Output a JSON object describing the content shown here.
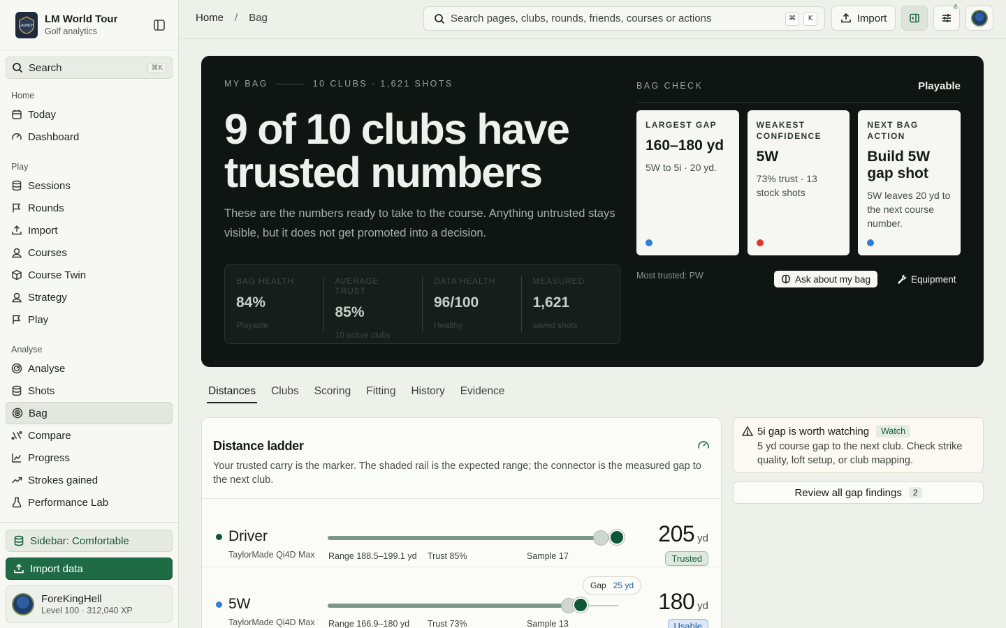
{
  "app": {
    "name": "LM World Tour",
    "subtitle": "Golf analytics"
  },
  "sidebar": {
    "search_label": "Search",
    "search_shortcut": "⌘K",
    "sections": [
      {
        "title": "Home",
        "items": [
          {
            "label": "Today",
            "icon": "calendar-icon"
          },
          {
            "label": "Dashboard",
            "icon": "gauge-icon"
          }
        ]
      },
      {
        "title": "Play",
        "items": [
          {
            "label": "Sessions",
            "icon": "database-icon"
          },
          {
            "label": "Rounds",
            "icon": "flag-icon"
          },
          {
            "label": "Import",
            "icon": "upload-icon"
          },
          {
            "label": "Courses",
            "icon": "map-pin-icon"
          },
          {
            "label": "Course Twin",
            "icon": "cube-icon"
          },
          {
            "label": "Strategy",
            "icon": "map-pin-icon"
          },
          {
            "label": "Play",
            "icon": "flag-icon"
          }
        ]
      },
      {
        "title": "Analyse",
        "items": [
          {
            "label": "Analyse",
            "icon": "radar-icon"
          },
          {
            "label": "Shots",
            "icon": "database-icon"
          },
          {
            "label": "Bag",
            "icon": "target-icon",
            "active": true
          },
          {
            "label": "Compare",
            "icon": "compare-icon"
          },
          {
            "label": "Progress",
            "icon": "chart-line-icon"
          },
          {
            "label": "Strokes gained",
            "icon": "trend-icon"
          },
          {
            "label": "Performance Lab",
            "icon": "flask-icon"
          }
        ]
      }
    ],
    "density_label": "Sidebar: Comfortable",
    "import_label": "Import data",
    "user": {
      "name": "ForeKingHell",
      "level": "Level 100 · 312,040 XP"
    }
  },
  "header": {
    "breadcrumb": [
      "Home",
      "Bag"
    ],
    "breadcrumb_sep": "/",
    "search_placeholder": "Search pages, clubs, rounds, friends, courses or actions",
    "search_keys": [
      "⌘",
      "K"
    ],
    "import_label": "Import",
    "notification_count": "4"
  },
  "hero": {
    "eyebrow_left": "MY BAG",
    "eyebrow_right": "10 CLUBS · 1,621 SHOTS",
    "title": "9 of 10 clubs have trusted numbers",
    "description": "These are the numbers ready to take to the course. Anything untrusted stays visible, but it does not get promoted into a decision.",
    "stats": [
      {
        "label": "BAG HEALTH",
        "value": "84%",
        "sub": "Playable"
      },
      {
        "label": "AVERAGE TRUST",
        "value": "85%",
        "sub": "10 active clubs"
      },
      {
        "label": "DATA HEALTH",
        "value": "96/100",
        "sub": "Healthy"
      },
      {
        "label": "MEASURED",
        "value": "1,621",
        "sub": "saved shots"
      }
    ],
    "bag_check": {
      "title": "BAG CHECK",
      "status": "Playable",
      "cards": [
        {
          "label": "LARGEST GAP",
          "value": "160–180 yd",
          "note": "5W to 5i · 20 yd.",
          "dot_color": "#2f7fd6"
        },
        {
          "label": "WEAKEST CONFIDENCE",
          "value": "5W",
          "note": "73% trust · 13 stock shots",
          "dot_color": "#e0392b"
        },
        {
          "label": "NEXT BAG ACTION",
          "value": "Build 5W gap shot",
          "note": "5W leaves 20 yd to the next course number.",
          "dot_color": "#2f7fd6"
        }
      ],
      "most_trusted": "Most trusted: PW",
      "ask_label": "Ask about my bag",
      "equipment_label": "Equipment"
    }
  },
  "tabs": [
    "Distances",
    "Clubs",
    "Scoring",
    "Fitting",
    "History",
    "Evidence"
  ],
  "active_tab": "Distances",
  "ladder": {
    "title": "Distance ladder",
    "description": "Your trusted carry is the marker. The shaded rail is the expected range; the connector is the measured gap to the next club.",
    "clubs": [
      {
        "name": "Driver",
        "model": "TaylorMade Qi4D Max",
        "range_label": "Range",
        "range": "188.5–199.1 yd",
        "trust_label": "Trust",
        "trust": "85%",
        "sample_label": "Sample",
        "sample": "17",
        "carry": "205",
        "unit": "yd",
        "status": "Trusted",
        "dot_color": "#0e5736",
        "carry_position": 0.995,
        "range_position": 0.94
      },
      {
        "name": "5W",
        "model": "TaylorMade Qi4D Max",
        "range_label": "Range",
        "range": "166.9–180 yd",
        "trust_label": "Trust",
        "trust": "73%",
        "sample_label": "Sample",
        "sample": "13",
        "carry": "180",
        "unit": "yd",
        "status": "Usable",
        "dot_color": "#2f7fd6",
        "carry_position": 0.87,
        "range_position": 0.83
      }
    ],
    "gap": {
      "label": "Gap",
      "value": "25 yd"
    }
  },
  "finding": {
    "title": "5i gap is worth watching",
    "tag": "Watch",
    "body": "5 yd course gap to the next club. Check strike quality, loft setup, or club mapping."
  },
  "review": {
    "label": "Review all gap findings",
    "count": "2"
  }
}
